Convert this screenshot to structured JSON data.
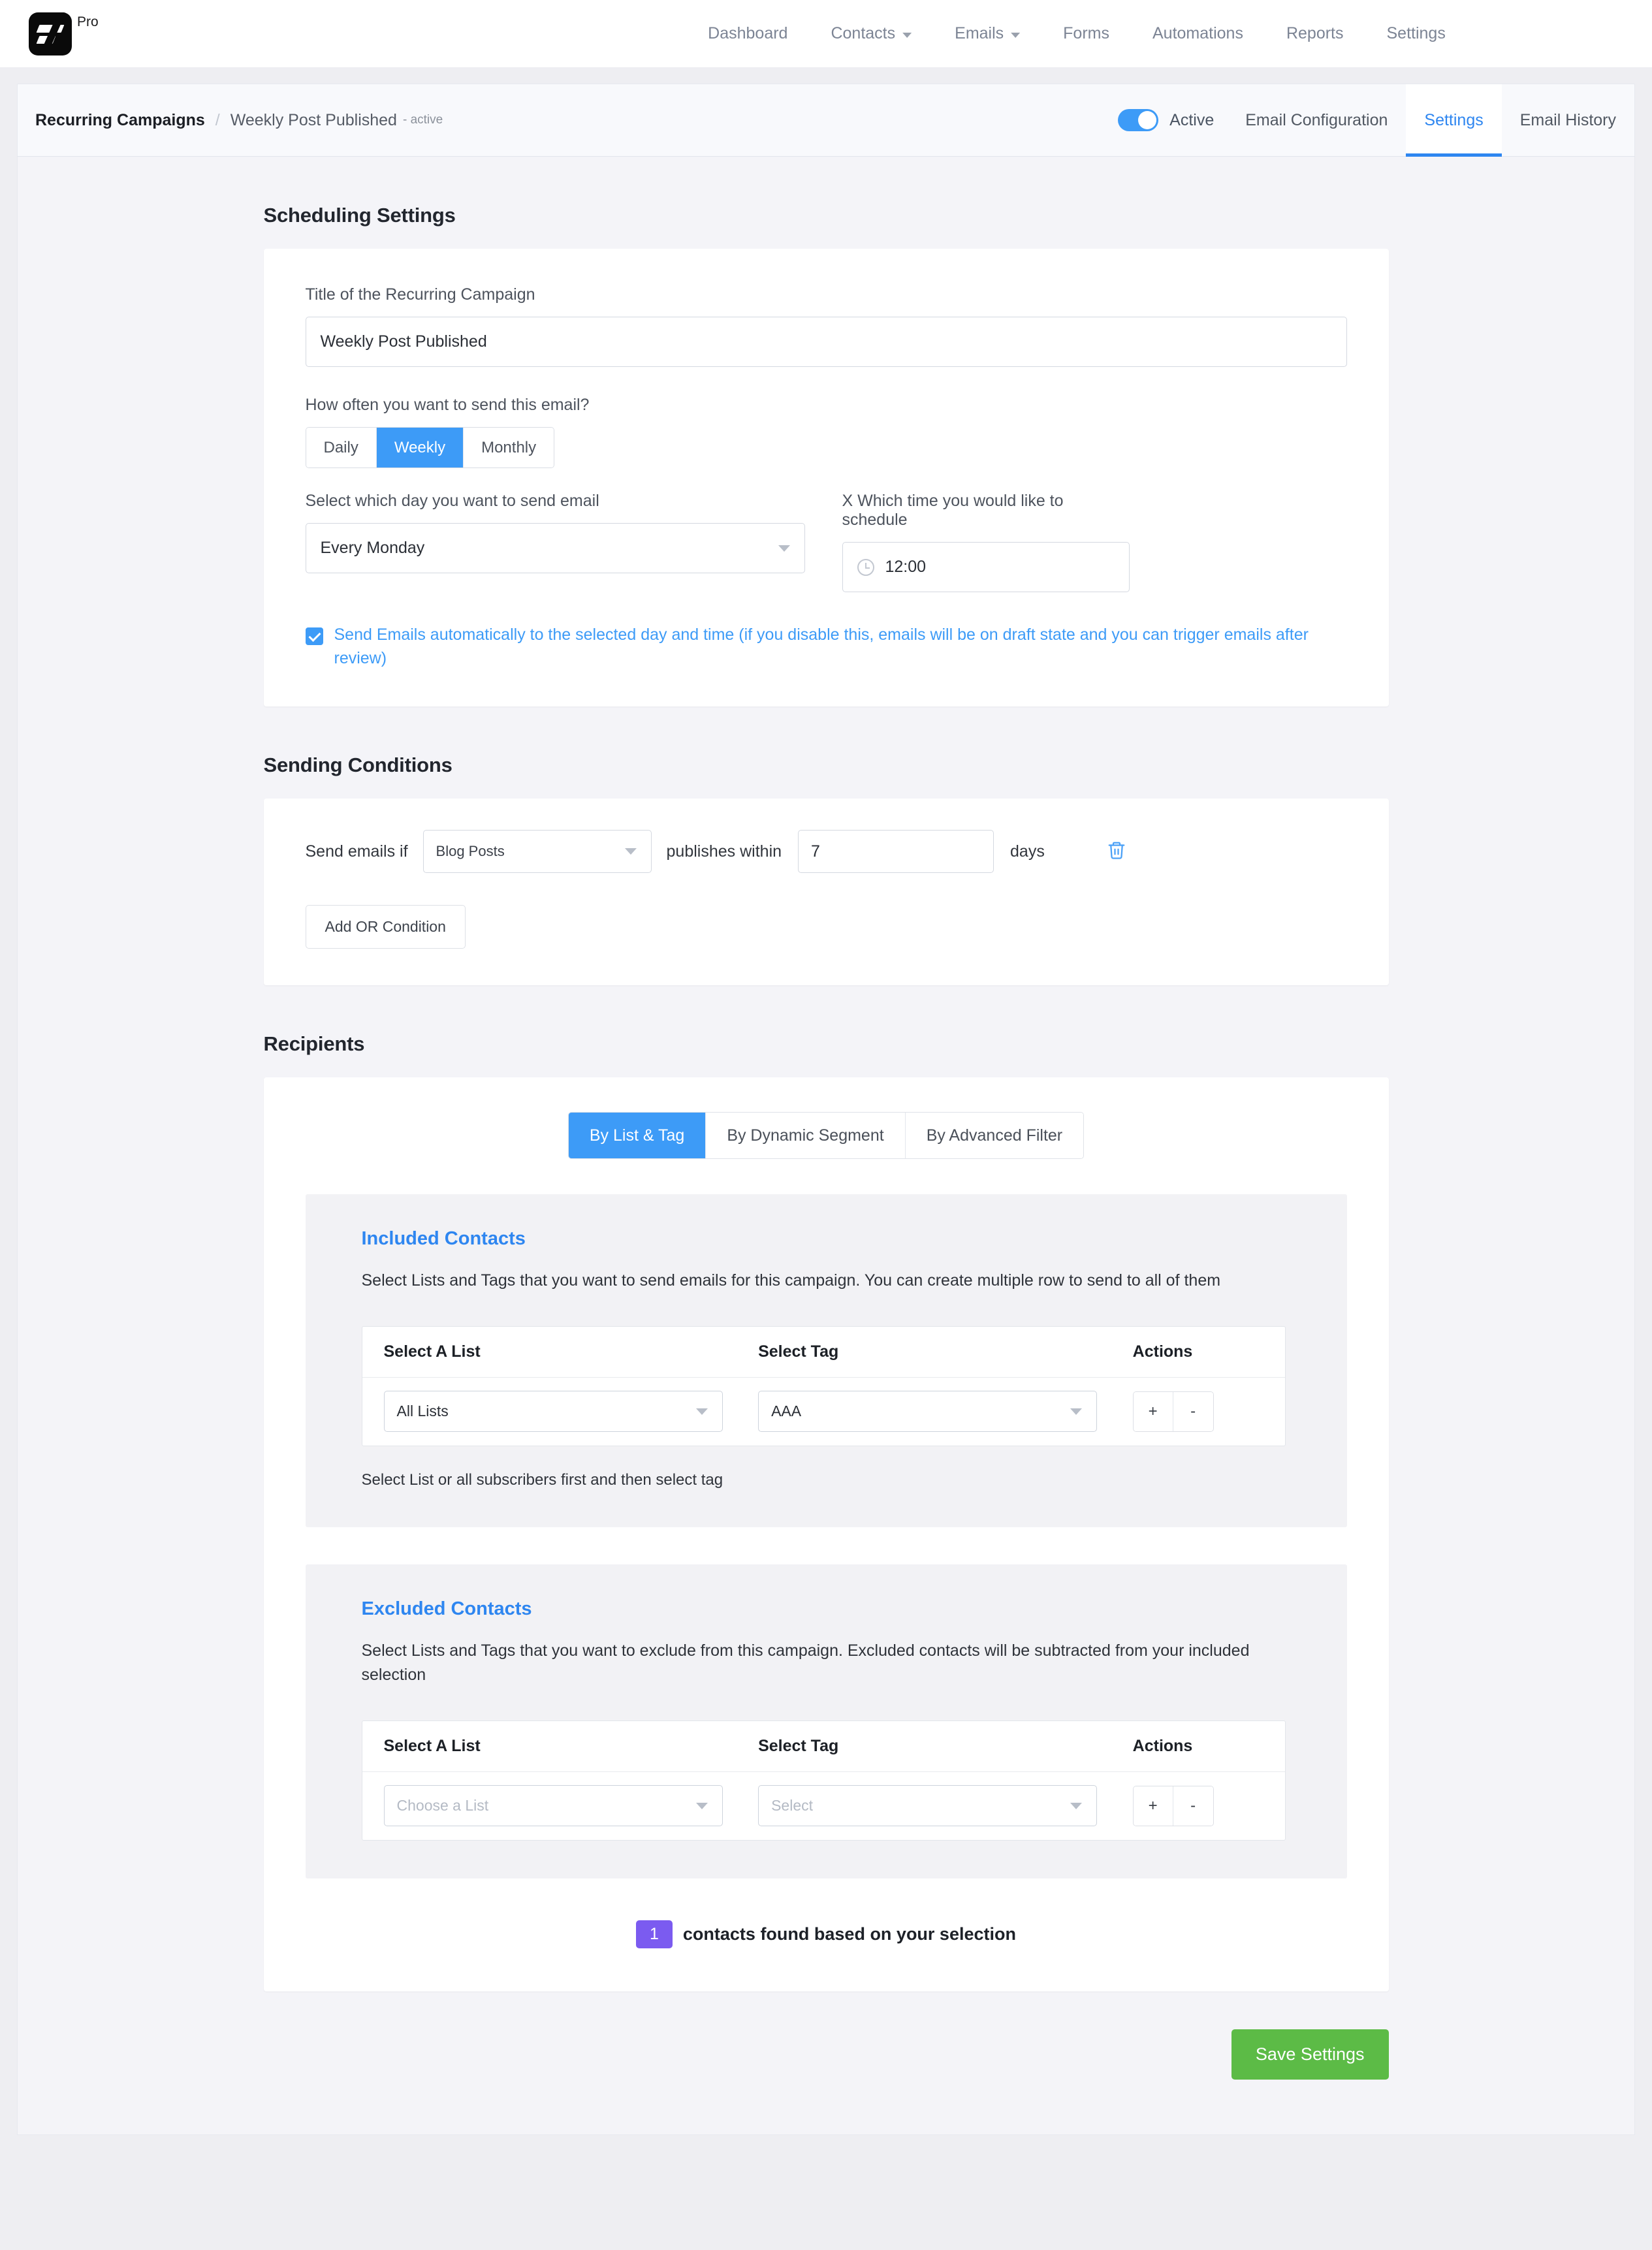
{
  "brand": {
    "name": "Pro",
    "logo_icon": "fluent-crm-logo-icon"
  },
  "mainnav": [
    {
      "label": "Dashboard",
      "caret": false
    },
    {
      "label": "Contacts",
      "caret": true
    },
    {
      "label": "Emails",
      "caret": true
    },
    {
      "label": "Forms",
      "caret": false
    },
    {
      "label": "Automations",
      "caret": false
    },
    {
      "label": "Reports",
      "caret": false
    },
    {
      "label": "Settings",
      "caret": false
    }
  ],
  "breadcrumb": {
    "root": "Recurring Campaigns",
    "separator": "/",
    "current": "Weekly Post Published",
    "status": "- active"
  },
  "header": {
    "toggle_state": "on",
    "toggle_label": "Active",
    "tabs": [
      {
        "label": "Email Configuration",
        "active": false
      },
      {
        "label": "Settings",
        "active": true
      },
      {
        "label": "Email History",
        "active": false
      }
    ]
  },
  "scheduling": {
    "section_title": "Scheduling Settings",
    "title_label": "Title of the Recurring Campaign",
    "title_value": "Weekly Post Published",
    "frequency_label": "How often you want to send this email?",
    "frequency_options": [
      "Daily",
      "Weekly",
      "Monthly"
    ],
    "frequency_selected": "Weekly",
    "day_label": "Select which day you want to send email",
    "day_value": "Every Monday",
    "time_label": "X Which time you would like to schedule",
    "time_value": "12:00",
    "auto_send_checked": true,
    "auto_send_text": "Send Emails automatically to the selected day and time (if you disable this, emails will be on draft state and you can trigger emails after review)"
  },
  "conditions": {
    "section_title": "Sending Conditions",
    "prefix": "Send emails if",
    "source_value": "Blog Posts",
    "middle": "publishes within",
    "days_value": "7",
    "suffix": "days",
    "delete_icon": "trash-icon",
    "add_or_label": "Add OR Condition"
  },
  "recipients": {
    "section_title": "Recipients",
    "tabs": [
      {
        "label": "By List & Tag",
        "active": true
      },
      {
        "label": "By Dynamic Segment",
        "active": false
      },
      {
        "label": "By Advanced Filter",
        "active": false
      }
    ],
    "included": {
      "title": "Included Contacts",
      "description": "Select Lists and Tags that you want to send emails for this campaign. You can create multiple row to send to all of them",
      "columns": [
        "Select A List",
        "Select Tag",
        "Actions"
      ],
      "row": {
        "list": "All Lists",
        "tag": "AAA",
        "add": "+",
        "remove": "-"
      },
      "hint": "Select List or all subscribers first and then select tag"
    },
    "excluded": {
      "title": "Excluded Contacts",
      "description": "Select Lists and Tags that you want to exclude from this campaign. Excluded contacts will be subtracted from your included selection",
      "columns": [
        "Select A List",
        "Select Tag",
        "Actions"
      ],
      "row": {
        "list_placeholder": "Choose a List",
        "tag_placeholder": "Select",
        "add": "+",
        "remove": "-"
      }
    },
    "found_count": "1",
    "found_text": "contacts found based on your selection"
  },
  "footer": {
    "save_label": "Save Settings"
  },
  "colors": {
    "accent_blue": "#3d9bf7",
    "link_blue": "#2e86f0",
    "badge_purple": "#7b5bf0",
    "save_green": "#5cbb46",
    "page_bg": "#f4f4f8"
  }
}
